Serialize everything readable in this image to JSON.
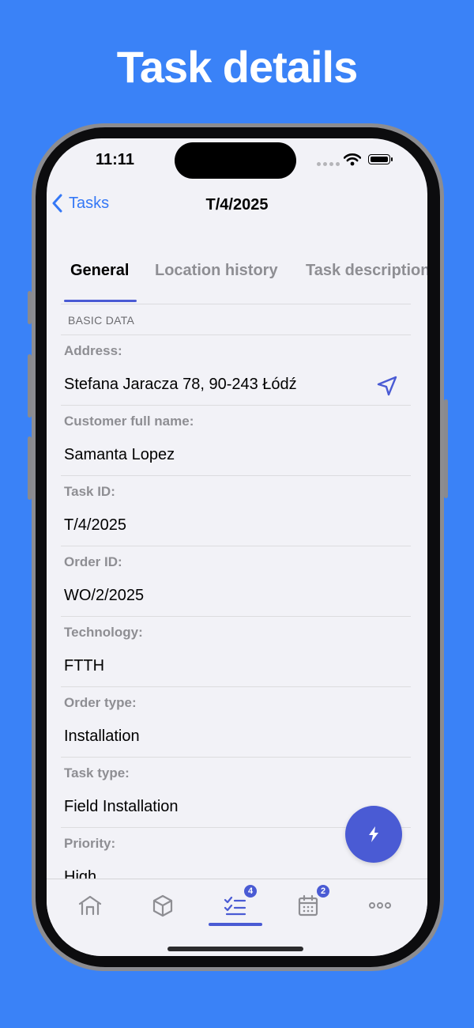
{
  "headline": "Task details",
  "status_bar": {
    "time": "11:11"
  },
  "nav": {
    "back_label": "Tasks",
    "title": "T/4/2025"
  },
  "tabs": [
    {
      "label": "General",
      "active": true
    },
    {
      "label": "Location history",
      "active": false
    },
    {
      "label": "Task description",
      "active": false
    }
  ],
  "section": {
    "header": "BASIC DATA"
  },
  "fields": [
    {
      "label": "Address:",
      "value": "Stefana Jaracza 78, 90-243 Łódź"
    },
    {
      "label": "Customer full name:",
      "value": "Samanta Lopez"
    },
    {
      "label": "Task ID:",
      "value": "T/4/2025"
    },
    {
      "label": "Order ID:",
      "value": "WO/2/2025"
    },
    {
      "label": "Technology:",
      "value": "FTTH"
    },
    {
      "label": "Order type:",
      "value": "Installation"
    },
    {
      "label": "Task type:",
      "value": "Field Installation"
    },
    {
      "label": "Priority:",
      "value": "High"
    }
  ],
  "tab_bar": {
    "items": [
      {
        "icon": "home-icon",
        "badge": null,
        "active": false
      },
      {
        "icon": "box-icon",
        "badge": null,
        "active": false
      },
      {
        "icon": "task-list-icon",
        "badge": "4",
        "active": true
      },
      {
        "icon": "calendar-icon",
        "badge": "2",
        "active": false
      },
      {
        "icon": "more-icon",
        "badge": null,
        "active": false
      }
    ]
  },
  "colors": {
    "background": "#3a82f7",
    "accent": "#4a5bd4",
    "link": "#3478f6",
    "screen": "#f2f2f7",
    "label_gray": "#8e8e93"
  }
}
